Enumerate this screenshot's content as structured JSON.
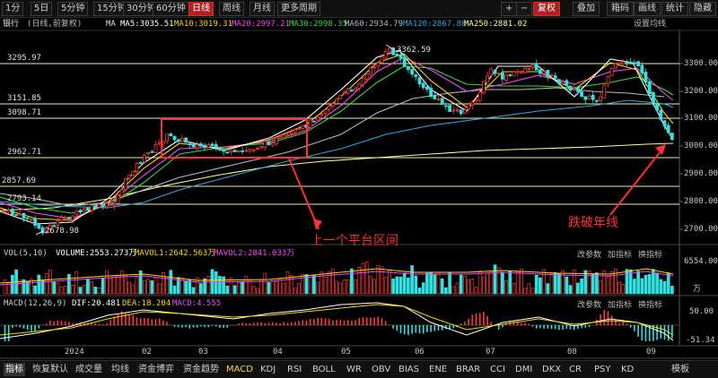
{
  "toolbar": {
    "periods": [
      "1分",
      "5日",
      "5分钟",
      "15分钟",
      "30分钟",
      "60分钟",
      "日线",
      "周线",
      "月线",
      "更多周期"
    ],
    "active_period": "日线",
    "right_buttons": [
      "+",
      "−",
      "复权",
      "叠加",
      "箱码",
      "画线",
      "统计",
      "隐藏"
    ],
    "fuquan_label": "复权"
  },
  "ma_line": {
    "stock": "银行",
    "mode": "(日线,前复权)",
    "ma_title": "MA",
    "ma5": "MA5:3035.51",
    "ma10": "MA10:3019.31",
    "ma20": "MA20:2997.21",
    "ma30": "MA30:2998.35",
    "ma60": "MA60:2934.79",
    "ma120": "MA120:2867.88",
    "ma250": "MA250:2881.02",
    "settings": "设置均线"
  },
  "price_levels": [
    "3295.97",
    "3151.85",
    "3098.71",
    "2962.71",
    "2857.69",
    "2793.14"
  ],
  "peak_label": "3362.59",
  "low_label": "2678.98",
  "y_axis": [
    "3300.00",
    "3200.00",
    "3100.00",
    "3000.00",
    "2900.00",
    "2800.00",
    "2700.00"
  ],
  "annotations": {
    "platform": "上一个平台区间",
    "break": "跌破年线"
  },
  "volume": {
    "title": "VOL(5,10)",
    "volume": "VOLUME:2553.273万",
    "mavol1": "MAVOL1:2642.563万",
    "mavol2": "MAVOL2:2841.033万",
    "max_label": "6554.00",
    "unit_label": "万"
  },
  "macd": {
    "title": "MACD(12,26,9)",
    "dif": "DIF:20.481",
    "dea": "DEA:18.204",
    "macd": "MACD:4.555",
    "top_label": "50.00",
    "bottom_label": "-51.34"
  },
  "sub_buttons": [
    "改参数",
    "加指标",
    "换指标"
  ],
  "x_axis": [
    "2024",
    "02",
    "03",
    "04",
    "05",
    "06",
    "07",
    "08",
    "09"
  ],
  "bottom_tabs": [
    "指标",
    "恢复默认",
    "成交量",
    "均线",
    "资金博弈",
    "资金趋势",
    "MACD",
    "KDJ",
    "RSI",
    "BOLL",
    "WR",
    "OBV",
    "BIAS",
    "ENE",
    "BRAR",
    "CCI",
    "DMI",
    "DKX",
    "CR",
    "PSY",
    "KD",
    "模板"
  ],
  "selected_tab": "MACD",
  "colors": {
    "up": "#ff3b3b",
    "down": "#33e0e0",
    "ma5": "#ffffff",
    "ma10": "#ffd700",
    "ma20": "#ff44ff",
    "ma30": "#33dd33",
    "ma60": "#bbbbbb",
    "ma120": "#22aaee",
    "ma250": "#ffff88"
  }
}
